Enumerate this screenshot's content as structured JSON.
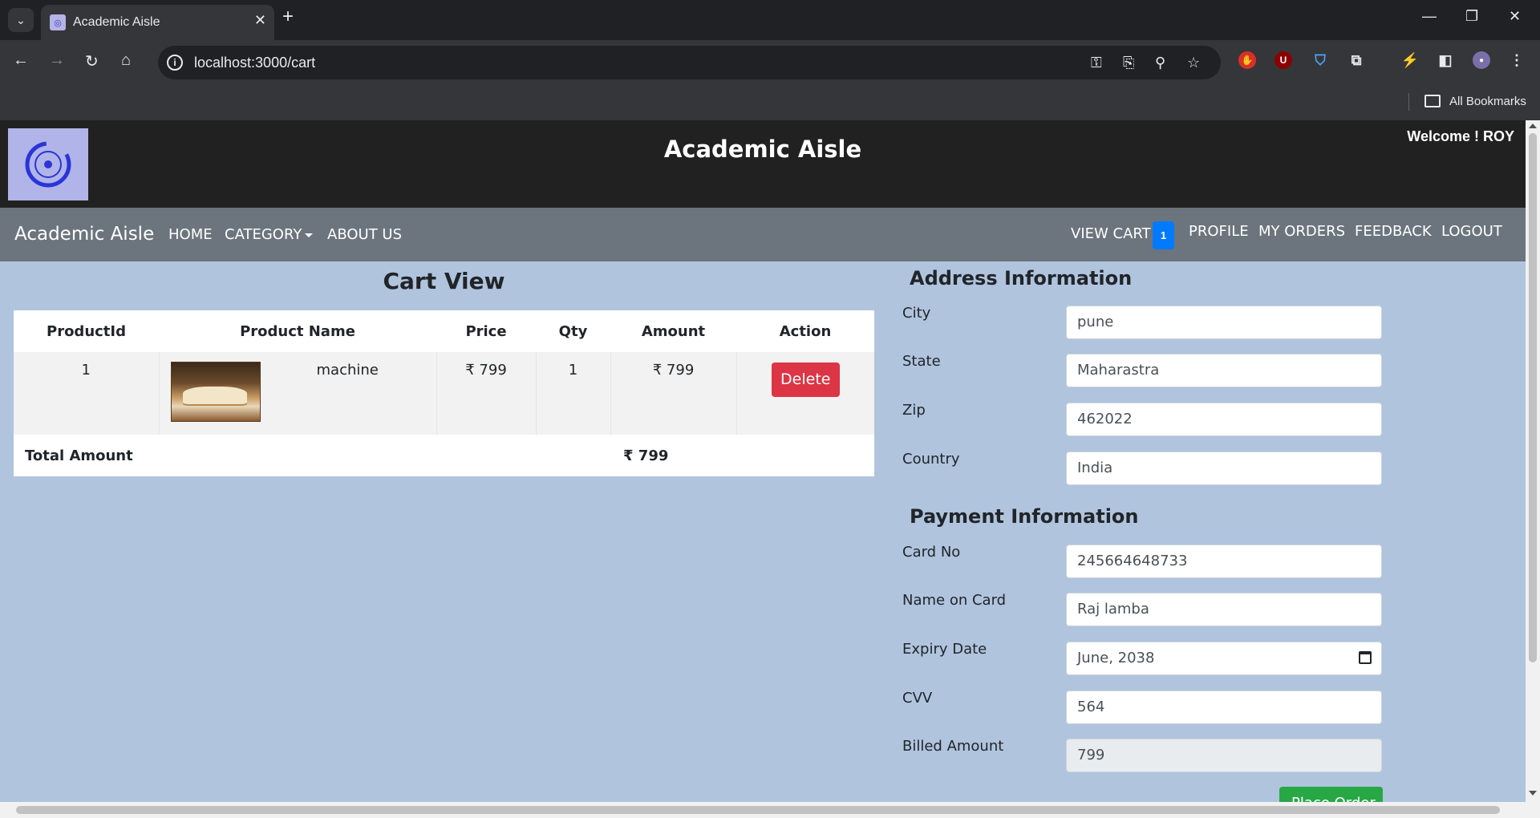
{
  "browser": {
    "tab_title": "Academic Aisle",
    "url": "localhost:3000/cart",
    "bookmarks_label": "All Bookmarks"
  },
  "header": {
    "site_title": "Academic Aisle",
    "welcome": "Welcome ! ROY"
  },
  "navbar": {
    "brand": "Academic Aisle",
    "home": "HOME",
    "category": "CATEGORY",
    "about": "ABOUT US",
    "view_cart": "VIEW CART",
    "cart_count": "1",
    "profile": "PROFILE",
    "my_orders": "MY ORDERS",
    "feedback": "FEEDBACK",
    "logout": "LOGOUT"
  },
  "cart": {
    "heading": "Cart View",
    "columns": [
      "ProductId",
      "Product Name",
      "Price",
      "Qty",
      "Amount",
      "Action"
    ],
    "items": [
      {
        "product_id": "1",
        "product_name": "machine",
        "price": "₹ 799",
        "qty": "1",
        "amount": "₹ 799",
        "action": "Delete"
      }
    ],
    "total_label": "Total Amount",
    "total_value": "₹ 799"
  },
  "address": {
    "title": "Address Information",
    "city_label": "City",
    "city": "pune",
    "state_label": "State",
    "state": "Maharastra",
    "zip_label": "Zip",
    "zip": "462022",
    "country_label": "Country",
    "country": "India"
  },
  "payment": {
    "title": "Payment Information",
    "card_no_label": "Card No",
    "card_no": "245664648733",
    "name_label": "Name on Card",
    "name": "Raj lamba",
    "expiry_label": "Expiry Date",
    "expiry": "June, 2038",
    "cvv_label": "CVV",
    "cvv": "564",
    "billed_label": "Billed Amount",
    "billed": "799",
    "place_order": "Place Order"
  }
}
